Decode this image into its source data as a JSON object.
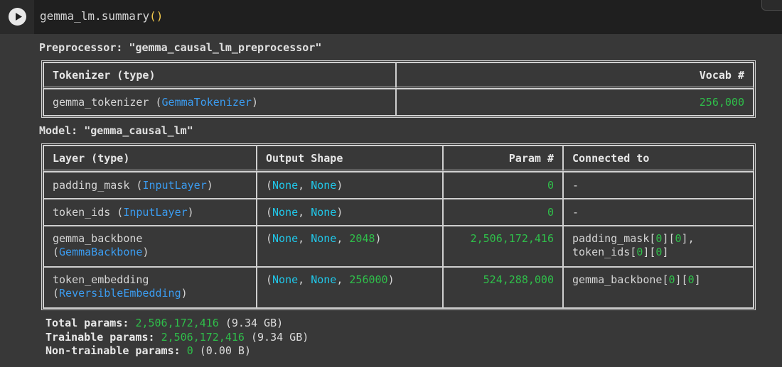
{
  "cell": {
    "code_fn": "gemma_lm.summary",
    "code_parens": "()"
  },
  "preprocessor": {
    "heading": "Preprocessor: \"gemma_causal_lm_preprocessor\"",
    "headers": [
      "Tokenizer (type)",
      "Vocab #"
    ],
    "row": {
      "name": "gemma_tokenizer",
      "type": "GemmaTokenizer",
      "vocab": "256,000"
    }
  },
  "model": {
    "heading": "Model: \"gemma_causal_lm\"",
    "headers": [
      "Layer (type)",
      "Output Shape",
      "Param #",
      "Connected to"
    ],
    "rows": [
      {
        "name": "padding_mask",
        "type": "InputLayer",
        "shape": [
          "None",
          "None"
        ],
        "params": "0",
        "connected": "-"
      },
      {
        "name": "token_ids",
        "type": "InputLayer",
        "shape": [
          "None",
          "None"
        ],
        "params": "0",
        "connected": "-"
      },
      {
        "name": "gemma_backbone",
        "type": "GemmaBackbone",
        "shape": [
          "None",
          "None",
          "2048"
        ],
        "params": "2,506,172,416",
        "connected_lines": [
          {
            "name": "padding_mask",
            "i": "0",
            "j": "0",
            "suffix": ","
          },
          {
            "name": "token_ids",
            "i": "0",
            "j": "0",
            "suffix": ""
          }
        ]
      },
      {
        "name": "token_embedding",
        "type": "ReversibleEmbedding",
        "shape": [
          "None",
          "None",
          "256000"
        ],
        "params": "524,288,000",
        "connected_lines": [
          {
            "name": "gemma_backbone",
            "i": "0",
            "j": "0",
            "suffix": ""
          }
        ]
      }
    ]
  },
  "totals": {
    "total_label": "Total params:",
    "total_value": "2,506,172,416",
    "total_size": "(9.34 GB)",
    "trainable_label": "Trainable params:",
    "trainable_value": "2,506,172,416",
    "trainable_size": "(9.34 GB)",
    "non_trainable_label": "Non-trainable params:",
    "non_trainable_value": "0",
    "non_trainable_size": "(0.00 B)"
  },
  "colors": {
    "type_blue": "#3b9cf0",
    "none_cyan": "#20c8ea",
    "number_green": "#2fbf4a"
  }
}
